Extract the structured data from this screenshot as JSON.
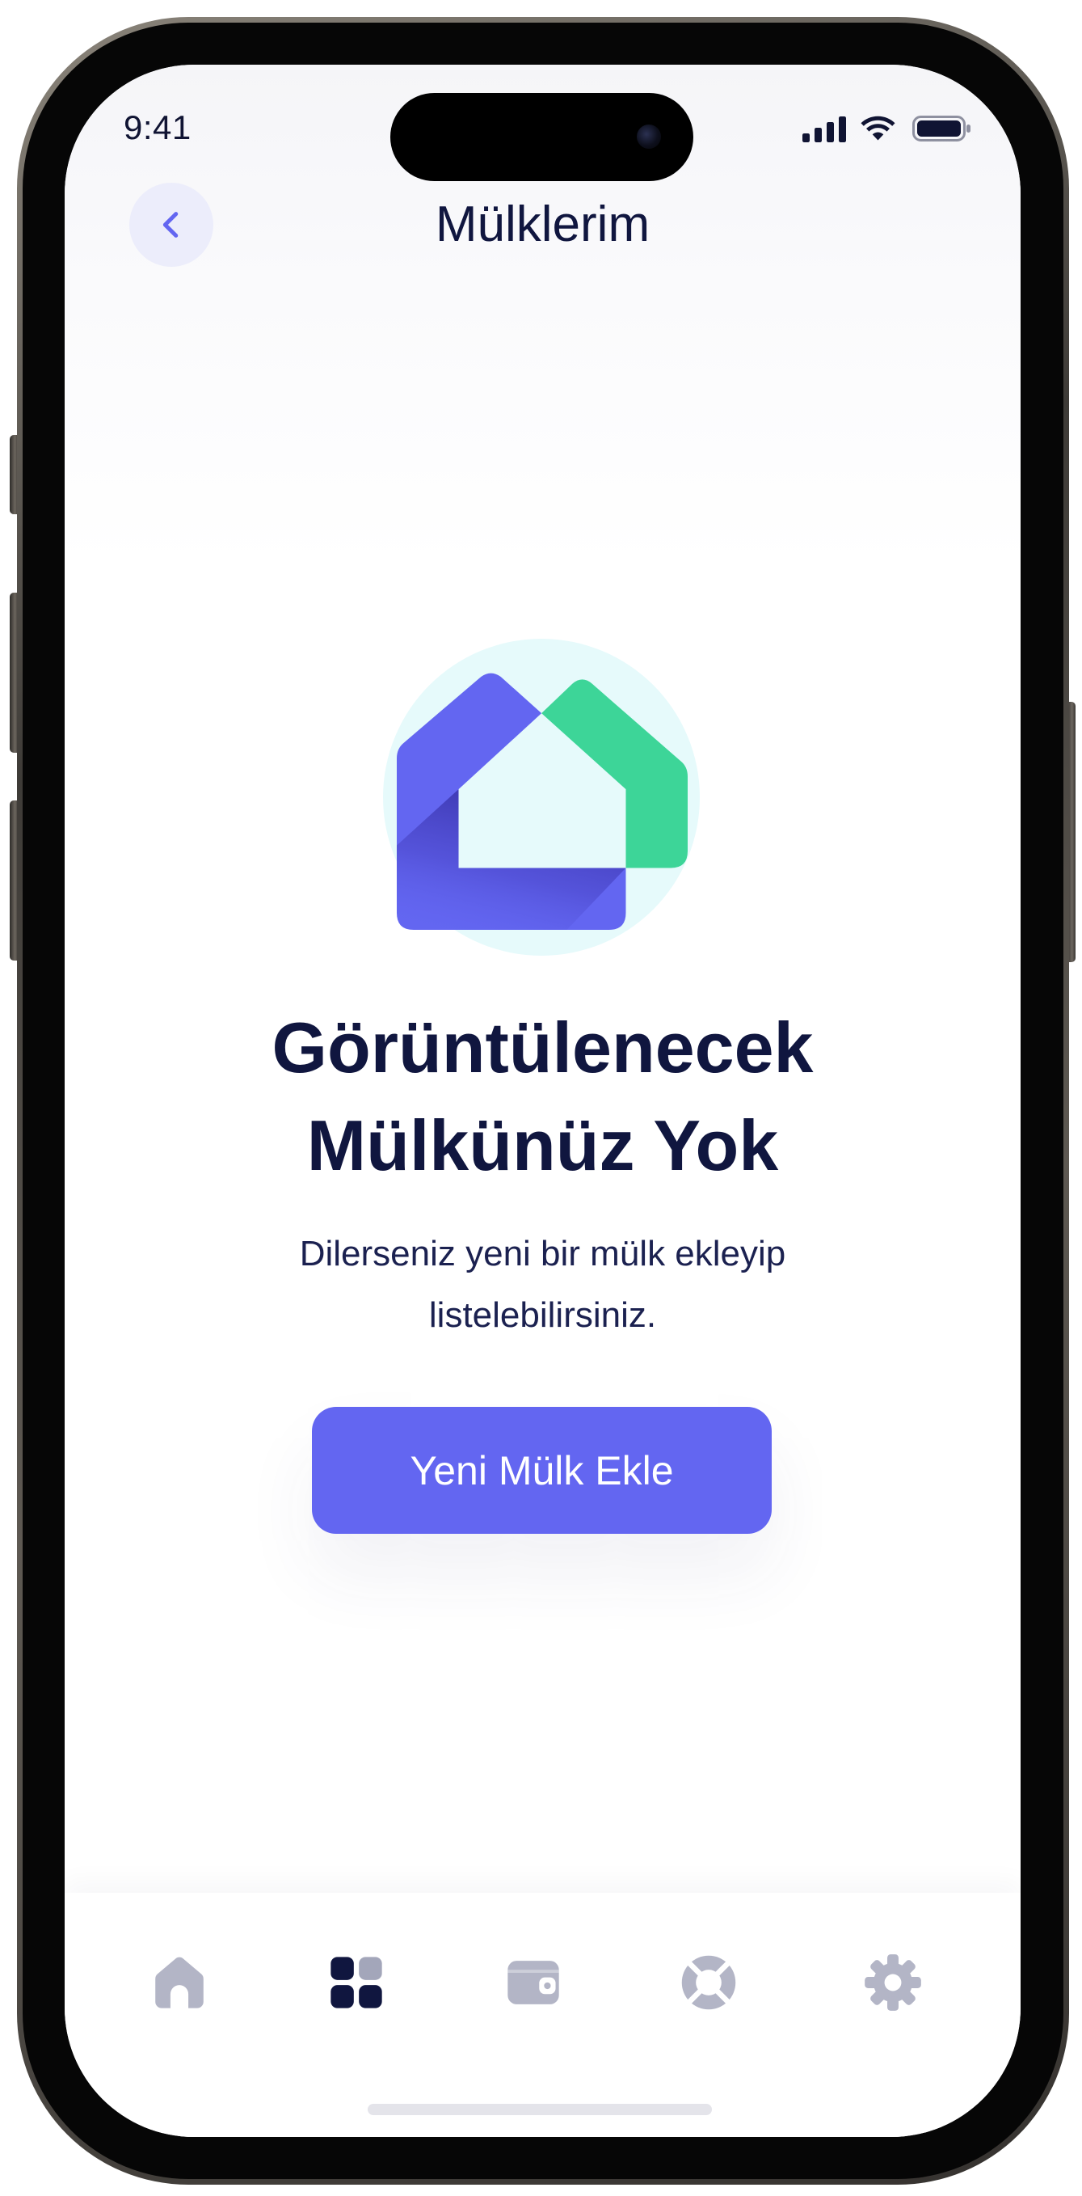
{
  "status_bar": {
    "time": "9:41",
    "icons": [
      "signal-icon",
      "wifi-icon",
      "battery-icon"
    ]
  },
  "header": {
    "title": "Mülklerim",
    "back_icon": "chevron-left-icon"
  },
  "empty_state": {
    "illustration_icon": "house-logo-icon",
    "title_lines": [
      "Görüntülenecek",
      "Mülkünüz Yok"
    ],
    "description_lines": [
      "Dilerseniz yeni bir mülk ekleyip",
      "listelebilirsiniz."
    ],
    "cta_label": "Yeni Mülk Ekle"
  },
  "bottom_nav": {
    "items": [
      {
        "icon": "home-icon",
        "active": false
      },
      {
        "icon": "grid-icon",
        "active": true
      },
      {
        "icon": "wallet-icon",
        "active": false
      },
      {
        "icon": "lifebuoy-icon",
        "active": false
      },
      {
        "icon": "gear-icon",
        "active": false
      }
    ]
  },
  "colors": {
    "accent": "#6366F1",
    "text_primary": "#10163F",
    "icon_inactive": "#B3B5C6",
    "brand_green": "#3DD598",
    "illustration_bg": "#E6FAFB",
    "back_button_bg": "#ECEDFB"
  }
}
